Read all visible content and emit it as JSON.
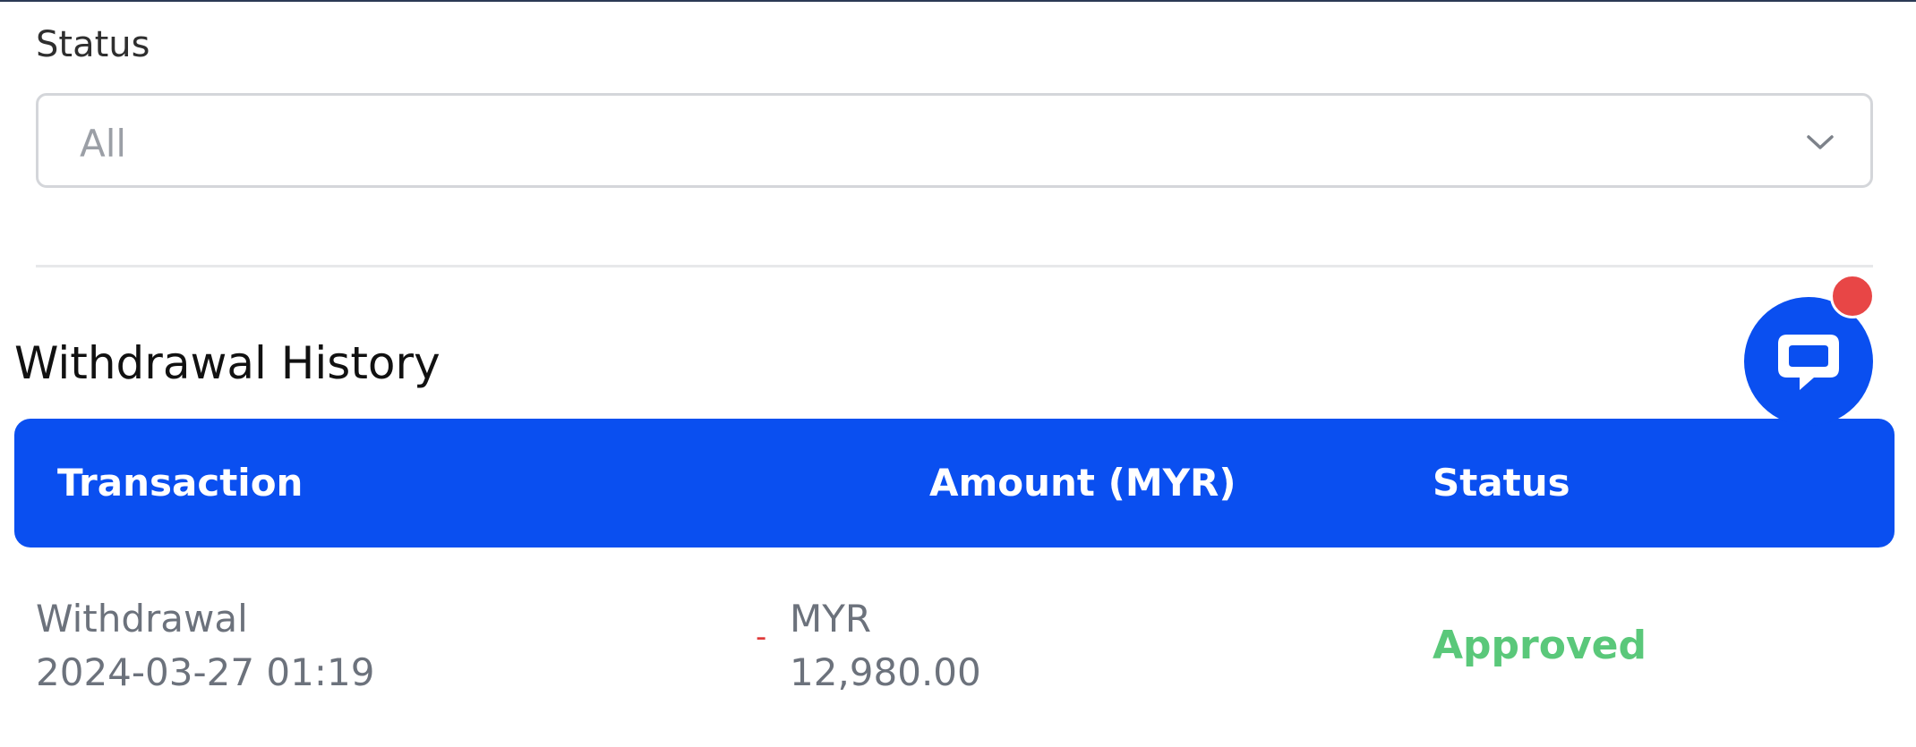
{
  "filter": {
    "label": "Status",
    "select_value": "All",
    "chevron_icon": "chevron-down-icon"
  },
  "section": {
    "title": "Withdrawal History"
  },
  "chat": {
    "icon": "chat-bubble-icon",
    "has_notification": true
  },
  "table": {
    "columns": [
      "Transaction",
      "Amount (MYR)",
      "Status"
    ],
    "rows": [
      {
        "type": "Withdrawal",
        "datetime": "2024-03-27 01:19",
        "sign": "-",
        "currency": "MYR",
        "amount": "12,980.00",
        "status": "Approved"
      }
    ]
  },
  "colors": {
    "primary": "#0a4ff0",
    "approved": "#5ac87a",
    "negative": "#e03a3a",
    "badge": "#e84646"
  }
}
